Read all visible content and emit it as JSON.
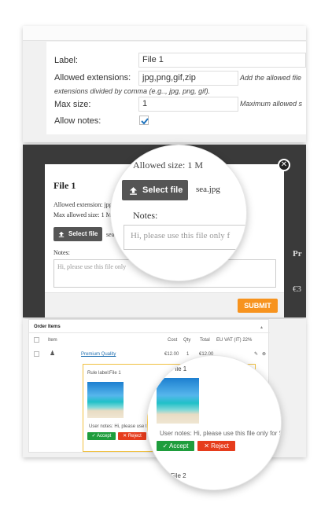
{
  "settings": {
    "label_label": "Label:",
    "label_value": "File 1",
    "extensions_label": "Allowed extensions:",
    "extensions_value": "jpg,png,gif,zip",
    "extensions_hint": "Add the allowed file",
    "extensions_hint2": "extensions divided by comma (e.g.., jpg, png, gif).",
    "maxsize_label": "Max size:",
    "maxsize_value": "1",
    "maxsize_hint": "Maximum allowed s",
    "notes_label": "Allow notes:",
    "notes_checked": true
  },
  "modal": {
    "backdrop_text": "Allowed size: 1 M",
    "title": "File 1",
    "allowed_ext_text": "Allowed extension: jpg",
    "max_size_text": "Max allowed size: 1 M",
    "select_file_label": "Select file",
    "file_name": "sea.jpg",
    "file_name_short": "sea",
    "notes_label": "Notes:",
    "notes_text": "Hi, please use this file only f",
    "notes_text_short": "Hi, please use this file only",
    "submit_label": "SUBMIT",
    "side_text_1": "Pr",
    "side_text_2": "€3"
  },
  "order": {
    "title": "Order Items",
    "columns": [
      "Item",
      "Cost",
      "Qty",
      "Total",
      "EU VAT (IT) 22%"
    ],
    "product_name": "Premium Quality",
    "cost": "€12.00",
    "qty": "1",
    "total": "€12.00",
    "rule_label_prefix": "Rule label:",
    "rule_label_value": "File 1",
    "file_label_2": "File 2",
    "label_suffix": "el: File 1",
    "user_notes_text": "User notes: Hi, please use th",
    "user_notes_full": "User notes: Hi, please use this file only for S",
    "accept_label": "Accept",
    "reject_label": "Reject"
  },
  "colors": {
    "accent_orange": "#f7931e",
    "accept_green": "#1e9d3c",
    "reject_red": "#e63c1c",
    "link_blue": "#2271b1"
  }
}
